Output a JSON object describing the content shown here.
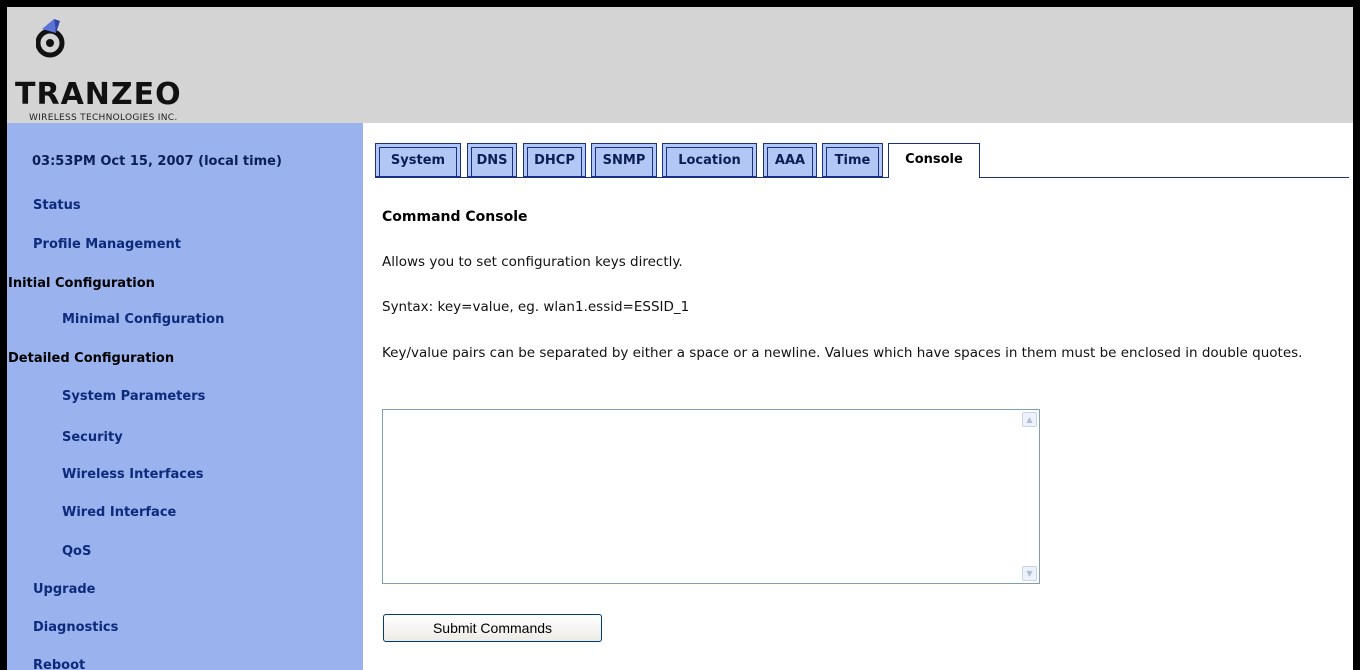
{
  "brand": {
    "name": "TRANZEO",
    "subtitle": "WIRELESS TECHNOLOGIES INC."
  },
  "sidebar": {
    "clock": "03:53PM Oct 15, 2007 (local time)",
    "items": [
      {
        "label": "Status"
      },
      {
        "label": "Profile Management"
      },
      {
        "label": "Initial Configuration"
      },
      {
        "label": "Minimal Configuration"
      },
      {
        "label": "Detailed Configuration"
      },
      {
        "label": "System Parameters"
      },
      {
        "label": "Security"
      },
      {
        "label": "Wireless Interfaces"
      },
      {
        "label": "Wired Interface"
      },
      {
        "label": "QoS"
      },
      {
        "label": "Upgrade"
      },
      {
        "label": "Diagnostics"
      },
      {
        "label": "Reboot"
      }
    ]
  },
  "tabs": [
    {
      "label": "System"
    },
    {
      "label": "DNS"
    },
    {
      "label": "DHCP"
    },
    {
      "label": "SNMP"
    },
    {
      "label": "Location"
    },
    {
      "label": "AAA"
    },
    {
      "label": "Time"
    },
    {
      "label": "Console"
    }
  ],
  "active_tab": "Console",
  "content": {
    "title": "Command Console",
    "intro": "Allows you to set configuration keys directly.",
    "syntax": "Syntax: key=value, eg. wlan1.essid=ESSID_1",
    "note": "Key/value pairs can be separated by either a space or a newline. Values which have spaces in them must be enclosed in double quotes.",
    "console_value": "",
    "submit_label": "Submit Commands"
  },
  "colors": {
    "sidebar_bg": "#9ab3ef",
    "header_bg": "#d4d4d4",
    "tab_bg": "#b3c7f5",
    "tab_border": "#1a2f86",
    "nav_text": "#0d2b7a"
  }
}
